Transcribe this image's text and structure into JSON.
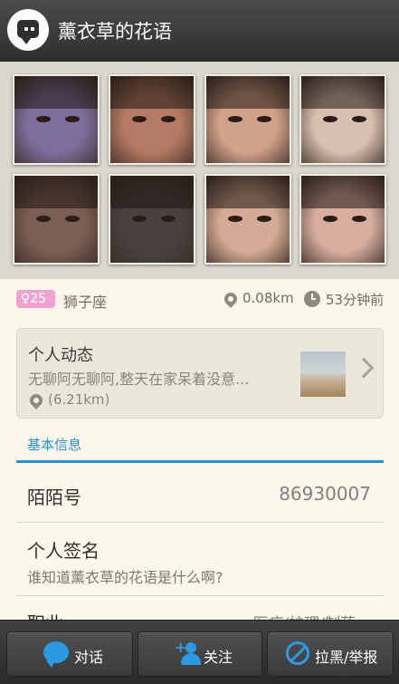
{
  "header": {
    "title": "薰衣草的花语",
    "app_icon": "chat-bubble-icon"
  },
  "colors": {
    "accent": "#2a9be3",
    "tab_blue": "#2a8ed3",
    "badge_pink": "#f0a3d3",
    "background": "#fbf7ea",
    "bar_dark": "#333333"
  },
  "photos": [
    {
      "tone": "#7d6f9c",
      "alt": "photo-1"
    },
    {
      "tone": "#b47a63",
      "alt": "photo-2"
    },
    {
      "tone": "#d3a28b",
      "alt": "photo-3"
    },
    {
      "tone": "#d8c0b1",
      "alt": "photo-4"
    },
    {
      "tone": "#7a5f54",
      "alt": "photo-5"
    },
    {
      "tone": "#4a4040",
      "alt": "photo-6"
    },
    {
      "tone": "#d4ab94",
      "alt": "photo-7"
    },
    {
      "tone": "#d7aea0",
      "alt": "photo-8"
    }
  ],
  "profile": {
    "age": "25",
    "gender_icon": "female-icon",
    "constellation": "狮子座",
    "distance": "0.08km",
    "last_active": "53分钟前"
  },
  "feed": {
    "title": "个人动态",
    "text": "无聊阿无聊阿,整天在家呆着没意...",
    "distance": "(6.21km)"
  },
  "section_tab": "基本信息",
  "info": {
    "momo_label": "陌陌号",
    "momo_value": "86930007",
    "signature_label": "个人签名",
    "signature_value": "谁知道薰衣草的花语是什么啊?",
    "job_label": "职业",
    "job_value": "医疗/护理/制药"
  },
  "bottom_bar": {
    "chat": "对话",
    "follow": "关注",
    "block": "拉黑/举报"
  }
}
